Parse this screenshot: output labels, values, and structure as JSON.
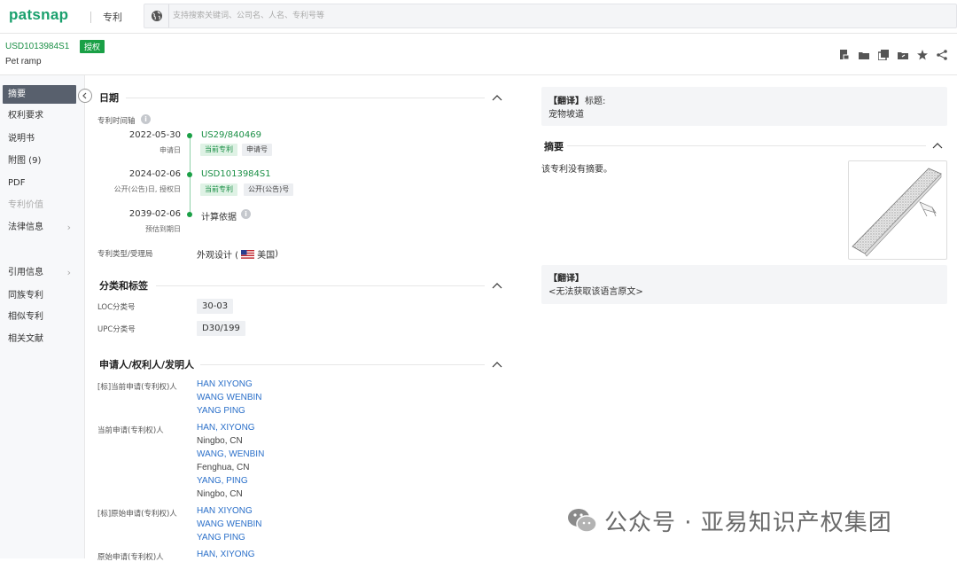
{
  "topbar": {
    "logo": "patsnap",
    "module": "专利",
    "search_placeholder": "支持搜索关键词、公司名、人名、专利号等"
  },
  "header": {
    "pub_number": "USD1013984S1",
    "status_badge": "授权",
    "title": "Pet ramp",
    "tools": [
      "pdf-export-icon",
      "folder-icon",
      "copy-icon",
      "share-folder-icon",
      "star-icon",
      "share-icon"
    ]
  },
  "sidebar": {
    "items": [
      {
        "label": "摘要",
        "state": "active"
      },
      {
        "label": "权利要求"
      },
      {
        "label": "说明书"
      },
      {
        "label": "附图 (9)"
      },
      {
        "label": "PDF"
      },
      {
        "label": "专利价值",
        "state": "disabled"
      },
      {
        "label": "法律信息",
        "arrow": "›"
      },
      {
        "label": "引用信息",
        "arrow": "›"
      },
      {
        "label": "同族专利"
      },
      {
        "label": "相似专利"
      },
      {
        "label": "相关文献"
      }
    ]
  },
  "dates": {
    "section_title": "日期",
    "timeline_label": "专利时间轴",
    "events": [
      {
        "date": "2022-05-30",
        "desc": "申请日",
        "number": "US29/840469",
        "tags": [
          "当前专利",
          "申请号"
        ]
      },
      {
        "date": "2024-02-06",
        "desc": "公开(公告)日, 授权日",
        "number": "USD1013984S1",
        "tags": [
          "当前专利",
          "公开(公告)号"
        ]
      },
      {
        "date": "2039-02-06",
        "desc": "预估到期日",
        "number": "计算依据"
      }
    ],
    "type_label": "专利类型/受理局",
    "type_value_prefix": "外观设计 (",
    "type_value_country": "美国",
    "type_value_suffix": ")"
  },
  "classification": {
    "section_title": "分类和标签",
    "loc_label": "LOC分类号",
    "loc_value": "30-03",
    "upc_label": "UPC分类号",
    "upc_value": "D30/199"
  },
  "applicants": {
    "section_title": "申请人/权利人/发明人",
    "groups": [
      {
        "label": "[标]当前申请(专利权)人",
        "names": [
          {
            "text": "HAN XIYONG",
            "link": true
          },
          {
            "text": "WANG WENBIN",
            "link": true
          },
          {
            "text": "YANG PING",
            "link": true
          }
        ]
      },
      {
        "label": "当前申请(专利权)人",
        "names": [
          {
            "text": "HAN, XIYONG",
            "link": true
          },
          {
            "text": "Ningbo, CN",
            "link": false
          },
          {
            "text": "WANG, WENBIN",
            "link": true
          },
          {
            "text": "Fenghua, CN",
            "link": false
          },
          {
            "text": "YANG, PING",
            "link": true
          },
          {
            "text": "Ningbo, CN",
            "link": false
          }
        ]
      },
      {
        "label": "[标]原始申请(专利权)人",
        "names": [
          {
            "text": "HAN XIYONG",
            "link": true
          },
          {
            "text": "WANG WENBIN",
            "link": true
          },
          {
            "text": "YANG PING",
            "link": true
          }
        ]
      },
      {
        "label": "原始申请(专利权)人",
        "names": [
          {
            "text": "HAN, XIYONG",
            "link": true
          }
        ]
      }
    ]
  },
  "right": {
    "translate_title_tag": "【翻译】",
    "translate_title_label": "标题:",
    "translate_title_value": "宠物坡道",
    "abstract_title": "摘要",
    "abstract_text": "该专利没有摘要。",
    "translate_abstract_tag": "【翻译】",
    "translate_abstract_text": "<无法获取该语言原文>"
  },
  "watermark": {
    "text": "公众号 · 亚易知识产权集团"
  },
  "colors": {
    "brand": "#1aa06d",
    "link": "#2a6fc9",
    "sidebar_active": "#58606d",
    "badge": "#1aa046"
  }
}
